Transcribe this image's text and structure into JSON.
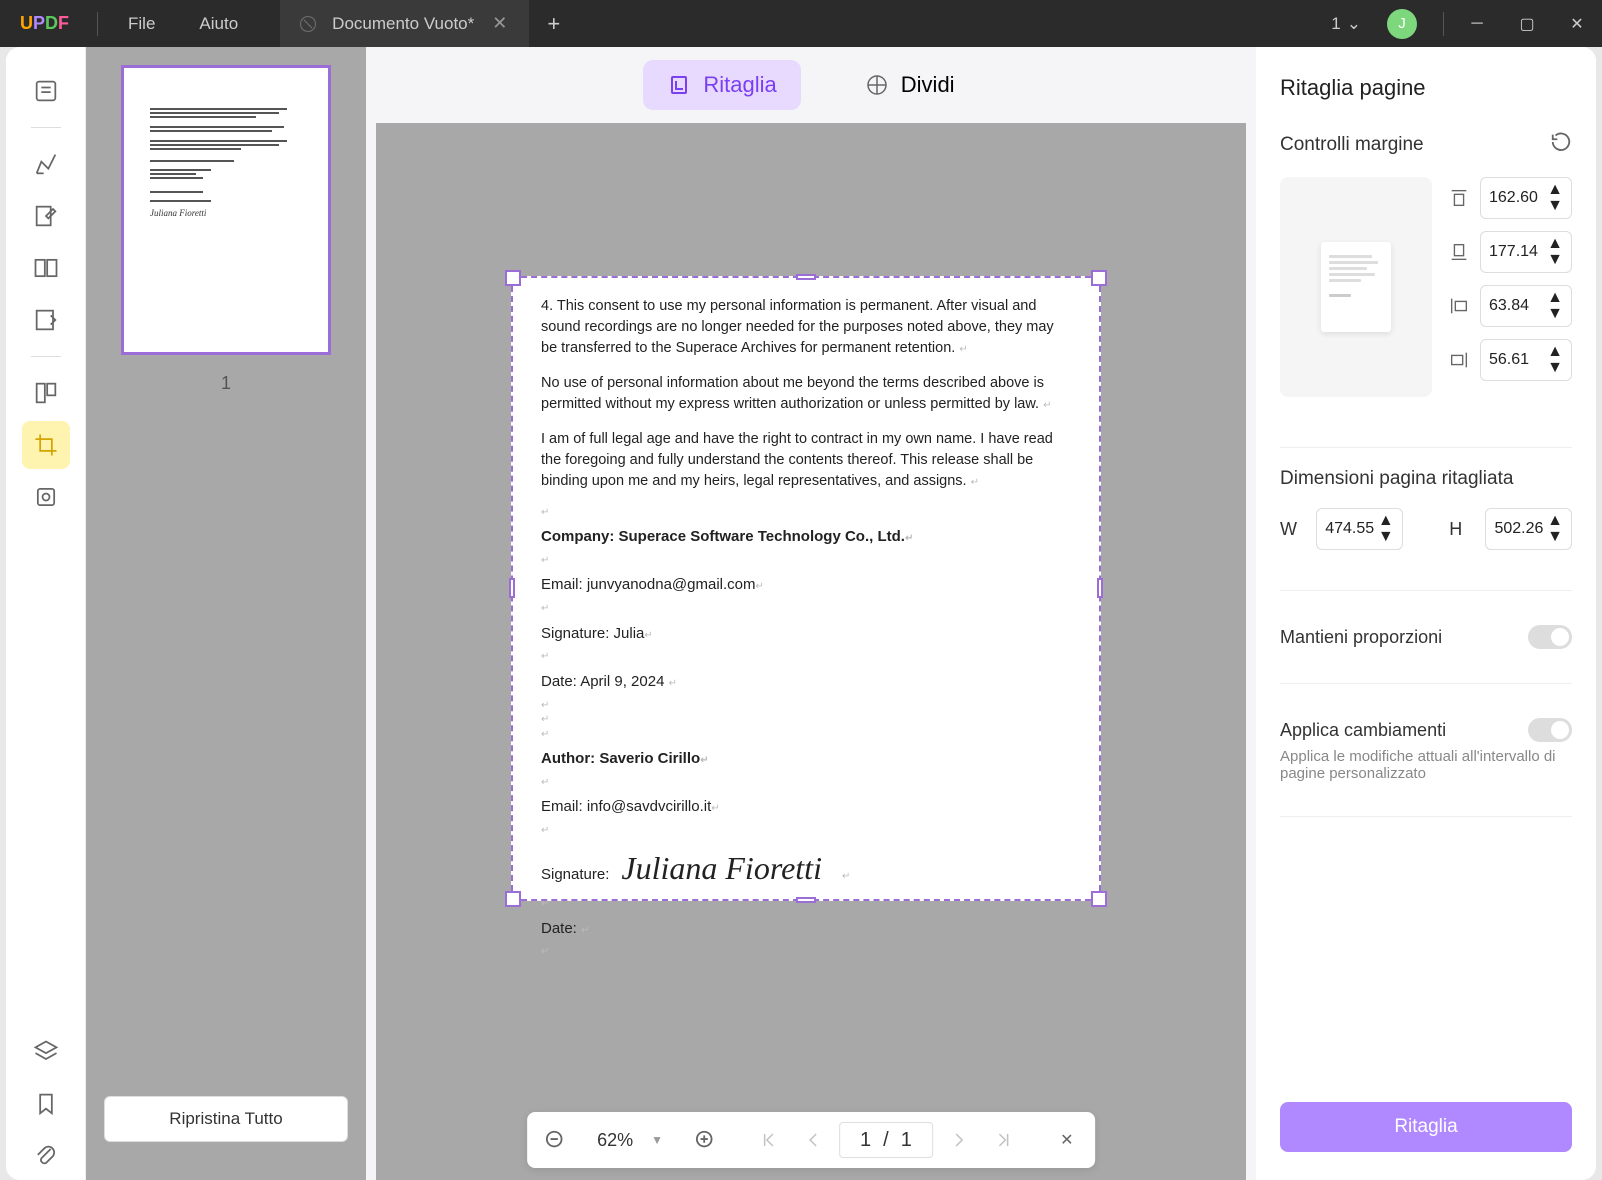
{
  "titlebar": {
    "menu_file": "File",
    "menu_help": "Aiuto",
    "tab_title": "Documento Vuoto*",
    "page_indicator": "1",
    "avatar_letter": "J"
  },
  "thumbnails": {
    "page_num": "1",
    "reset_btn": "Ripristina Tutto"
  },
  "modes": {
    "crop": "Ritaglia",
    "split": "Dividi"
  },
  "document": {
    "para1": "4. This consent to use my personal information is permanent. After visual and sound recordings are no longer needed for the purposes noted above, they may be transferred to the Superace Archives for permanent retention.",
    "para2": "No use of personal information about me beyond the terms described above is permitted without my express written authorization or unless permitted by law.",
    "para3": "I am of full legal age and have the right to contract in my own name. I have read the foregoing and fully understand the contents thereof. This release shall be binding upon me and my heirs, legal representatives, and assigns.",
    "company": "Company: Superace Software Technology Co., Ltd.",
    "email1_label": "Email: ",
    "email1_value": "junvyanodna@gmail.com",
    "sig1_label": "Signature: ",
    "sig1_value": "Julia",
    "date1_label": "Date: ",
    "date1_value": "April 9, 2024",
    "author": "Author: Saverio Cirillo",
    "email2_label": "Email: ",
    "email2_value": "info@savdvcirillo.it",
    "sig2_label": "Signature:",
    "sig2_value": "Juliana Fioretti",
    "date2_label": "Date: "
  },
  "zoombar": {
    "zoom": "62%",
    "page_current": "1",
    "page_sep": "/",
    "page_total": "1"
  },
  "panel": {
    "title": "Ritaglia pagine",
    "margin_section": "Controlli margine",
    "margin_top": "162.60",
    "margin_bottom": "177.14",
    "margin_left": "63.84",
    "margin_right": "56.61",
    "size_section": "Dimensioni pagina ritagliata",
    "width_label": "W",
    "width_value": "474.55",
    "height_label": "H",
    "height_value": "502.26",
    "keep_ratio": "Mantieni proporzioni",
    "apply_changes": "Applica cambiamenti",
    "apply_desc": "Applica le modifiche attuali all'intervallo di pagine personalizzato",
    "apply_btn": "Ritaglia"
  }
}
